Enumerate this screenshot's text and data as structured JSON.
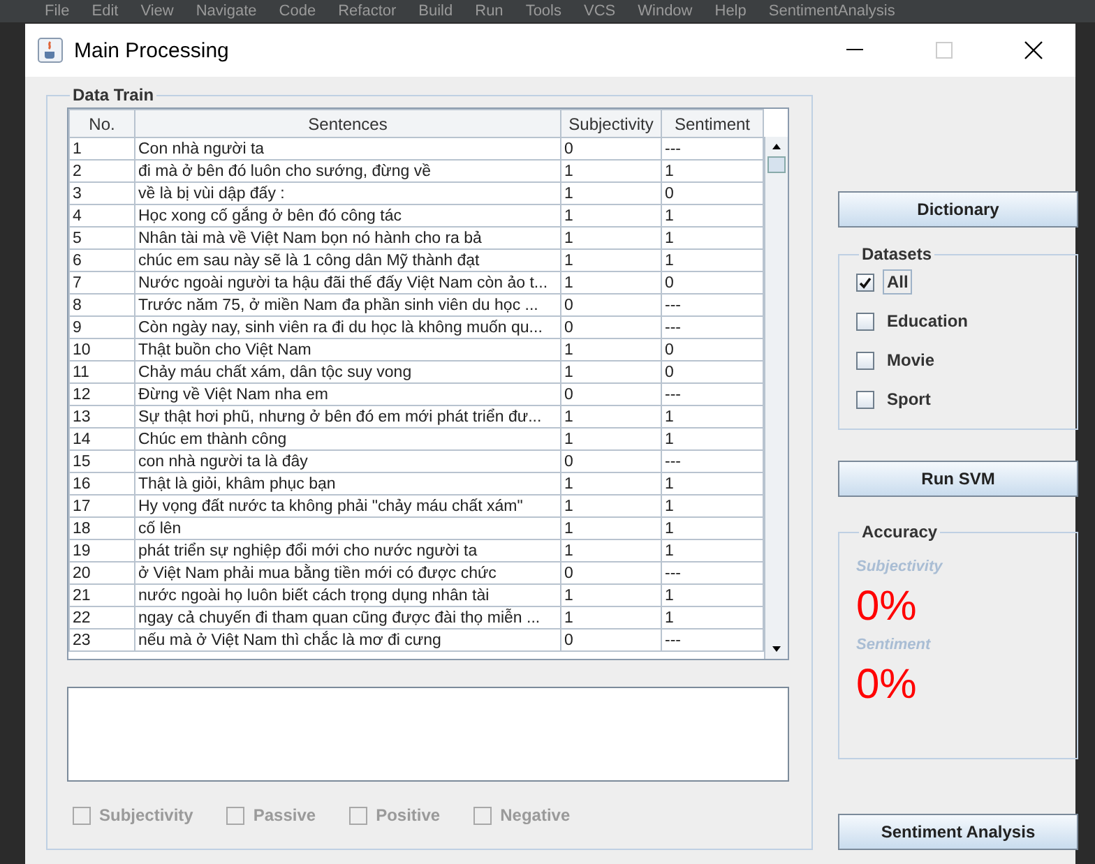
{
  "ide_menu": [
    "File",
    "Edit",
    "View",
    "Navigate",
    "Code",
    "Refactor",
    "Build",
    "Run",
    "Tools",
    "VCS",
    "Window",
    "Help",
    "SentimentAnalysis"
  ],
  "window": {
    "title": "Main Processing"
  },
  "data_train": {
    "title": "Data Train",
    "table": {
      "columns": [
        "No.",
        "Sentences",
        "Subjectivity",
        "Sentiment"
      ],
      "rows": [
        [
          "1",
          "Con nhà người ta",
          "0",
          "---"
        ],
        [
          "2",
          "đi mà ở bên đó luôn cho sướng, đừng về",
          "1",
          "1"
        ],
        [
          "3",
          "về là bị vùi dập đấy :",
          "1",
          "0"
        ],
        [
          "4",
          "Học xong cố gắng ở bên đó công tác",
          "1",
          "1"
        ],
        [
          "5",
          "Nhân tài mà về Việt Nam bọn nó hành cho ra bả",
          "1",
          "1"
        ],
        [
          "6",
          "chúc em sau này sẽ là 1 công dân Mỹ thành đạt",
          "1",
          "1"
        ],
        [
          "7",
          "Nước ngoài người ta hậu đãi thế đấy Việt Nam còn ảo t...",
          "1",
          "0"
        ],
        [
          "8",
          "Trước năm 75, ở miền Nam đa phần sinh viên du học ...",
          "0",
          "---"
        ],
        [
          "9",
          "Còn ngày nay, sinh viên ra đi du học là không muốn qu...",
          "0",
          "---"
        ],
        [
          "10",
          "Thật buồn cho Việt Nam",
          "1",
          "0"
        ],
        [
          "11",
          "Chảy máu chất xám, dân tộc suy vong",
          "1",
          "0"
        ],
        [
          "12",
          "Đừng về Việt Nam nha em",
          "0",
          "---"
        ],
        [
          "13",
          "Sự thật hơi phũ, nhưng ở bên đó em mới phát triển đư...",
          "1",
          "1"
        ],
        [
          "14",
          "Chúc em thành công",
          "1",
          "1"
        ],
        [
          "15",
          "con nhà người ta là đây",
          "0",
          "---"
        ],
        [
          "16",
          "Thật là giỏi, khâm phục bạn",
          "1",
          "1"
        ],
        [
          "17",
          "Hy vọng đất nước ta không phải \"chảy máu chất xám\"",
          "1",
          "1"
        ],
        [
          "18",
          "cố lên",
          "1",
          "1"
        ],
        [
          "19",
          "phát triển sự nghiệp đổi mới cho nước người ta",
          "1",
          "1"
        ],
        [
          "20",
          "ở Việt Nam phải mua bằng tiền mới có được chức",
          "0",
          "---"
        ],
        [
          "21",
          "nước ngoài họ luôn biết cách trọng dụng nhân tài",
          "1",
          "1"
        ],
        [
          "22",
          "ngay cả chuyến đi tham quan cũng được đài thọ miễn ...",
          "1",
          "1"
        ],
        [
          "23",
          "nếu mà ở Việt Nam thì chắc là mơ đi cưng",
          "0",
          "---"
        ]
      ]
    },
    "filters": [
      {
        "label": "Subjectivity",
        "checked": false,
        "disabled": true
      },
      {
        "label": "Passive",
        "checked": false,
        "disabled": true
      },
      {
        "label": "Positive",
        "checked": false,
        "disabled": true
      },
      {
        "label": "Negative",
        "checked": false,
        "disabled": true
      }
    ]
  },
  "dictionary_button": "Dictionary",
  "datasets": {
    "title": "Datasets",
    "items": [
      {
        "label": "All",
        "checked": true,
        "focused": true
      },
      {
        "label": "Education",
        "checked": false,
        "focused": false
      },
      {
        "label": "Movie",
        "checked": false,
        "focused": false
      },
      {
        "label": "Sport",
        "checked": false,
        "focused": false
      }
    ]
  },
  "run_button": "Run SVM",
  "accuracy": {
    "title": "Accuracy",
    "metrics": [
      {
        "label": "Subjectivity",
        "value": "0%"
      },
      {
        "label": "Sentiment",
        "value": "0%"
      }
    ]
  },
  "analysis_button": "Sentiment Analysis"
}
